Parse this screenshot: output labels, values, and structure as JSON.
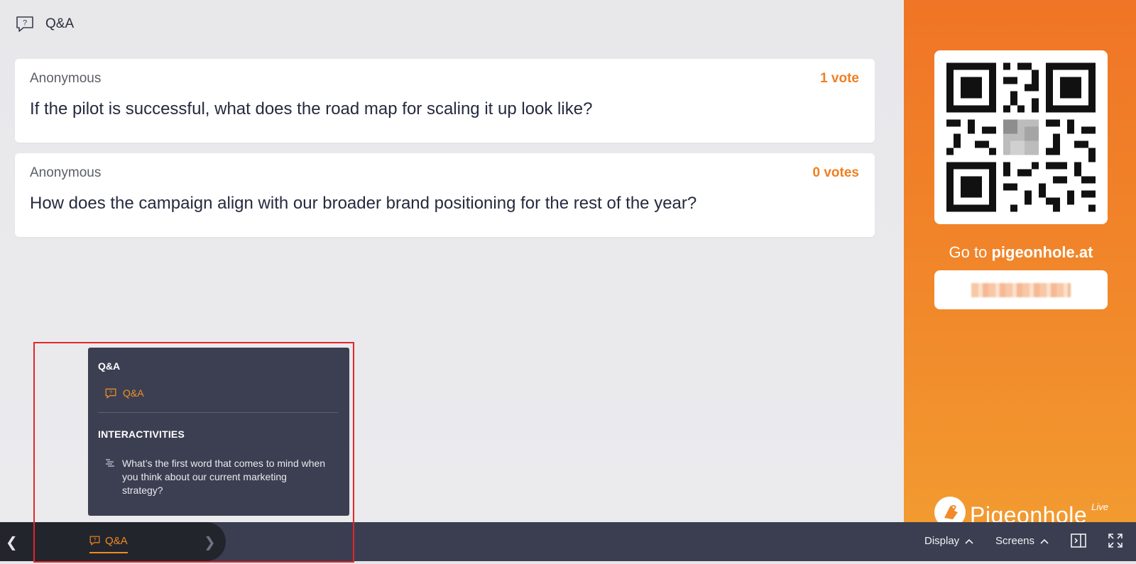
{
  "header": {
    "icon": "question-bubble-icon",
    "title": "Q&A"
  },
  "questions": [
    {
      "author": "Anonymous",
      "votes": "1 vote",
      "text": "If the pilot is successful, what does the road map for scaling it up look like?"
    },
    {
      "author": "Anonymous",
      "votes": "0 votes",
      "text": "How does the campaign align with our broader brand positioning for the rest of the year?"
    }
  ],
  "side_panel": {
    "goto_prefix": "Go to ",
    "goto_site": "pigeonhole.at",
    "brand_name": "Pigeonhole",
    "brand_suffix": "Live",
    "accent_color": "#f07f22"
  },
  "popup": {
    "section_qa": "Q&A",
    "qa_item": "Q&A",
    "section_interactivities": "INTERACTIVITIES",
    "interactivity_item": "What’s the first word that comes to mind when you think about our current marketing strategy?"
  },
  "toolbar": {
    "active_tab": "Q&A",
    "display_label": "Display",
    "screens_label": "Screens"
  }
}
